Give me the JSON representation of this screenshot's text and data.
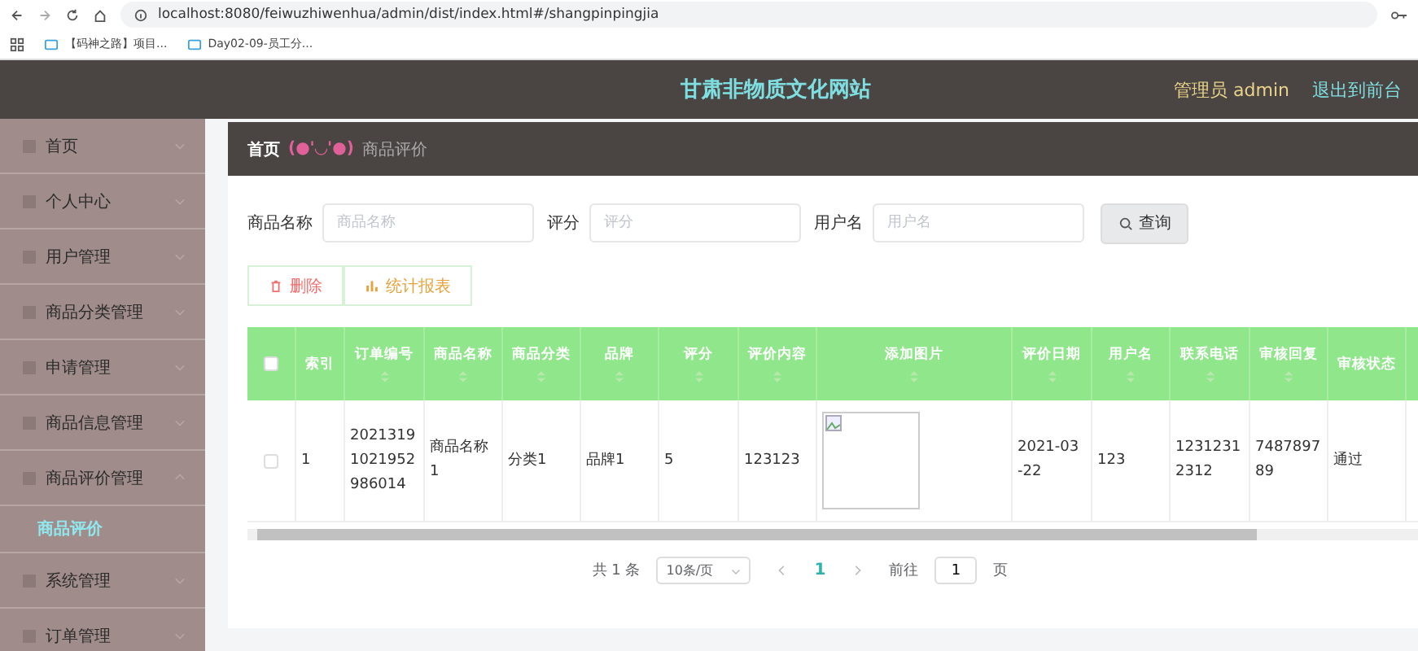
{
  "browser": {
    "url": "localhost:8080/feiwuzhiwenhua/admin/dist/index.html#/shangpinpingjia",
    "bookmarks": [
      "【码神之路】项目...",
      "Day02-09-员工分..."
    ]
  },
  "header": {
    "title": "甘肃非物质文化网站",
    "user": "管理员 admin",
    "exit": "退出到前台"
  },
  "sidebar": {
    "items": [
      {
        "label": "首页",
        "expanded": false
      },
      {
        "label": "个人中心",
        "expanded": false
      },
      {
        "label": "用户管理",
        "expanded": false
      },
      {
        "label": "商品分类管理",
        "expanded": false
      },
      {
        "label": "申请管理",
        "expanded": false
      },
      {
        "label": "商品信息管理",
        "expanded": false
      },
      {
        "label": "商品评价管理",
        "expanded": true,
        "children": [
          {
            "label": "商品评价",
            "selected": true
          }
        ]
      },
      {
        "label": "系统管理",
        "expanded": false
      },
      {
        "label": "订单管理",
        "expanded": false
      }
    ]
  },
  "breadcrumb": {
    "home": "首页",
    "separator": "(●'◡'●)",
    "current": "商品评价"
  },
  "search": {
    "fields": [
      {
        "label": "商品名称",
        "placeholder": "商品名称"
      },
      {
        "label": "评分",
        "placeholder": "评分"
      },
      {
        "label": "用户名",
        "placeholder": "用户名"
      }
    ],
    "button": "查询"
  },
  "actions": [
    {
      "kind": "delete",
      "label": "删除"
    },
    {
      "kind": "report",
      "label": "统计报表"
    }
  ],
  "table": {
    "header_checked": false,
    "columns": [
      "索引",
      "订单编号",
      "商品名称",
      "商品分类",
      "品牌",
      "评分",
      "评价内容",
      "添加图片",
      "评价日期",
      "用户名",
      "联系电话",
      "审核回复",
      "审核状态"
    ],
    "rows": [
      {
        "checked": false,
        "cells": [
          "1",
          "2021319 1021952 986014",
          "商品名称 1",
          "分类1",
          "品牌1",
          "5",
          "123123",
          {
            "kind": "image"
          },
          "2021-03 -22",
          "123",
          "1231231 2312",
          "7487897 89",
          "通过"
        ]
      }
    ]
  },
  "pagination": {
    "total": "共 1 条",
    "page_size": "10条/页",
    "pages": [
      {
        "label": "1",
        "selected": true
      }
    ],
    "goto_label": "前往",
    "goto_value": "1",
    "goto_suffix": "页"
  }
}
